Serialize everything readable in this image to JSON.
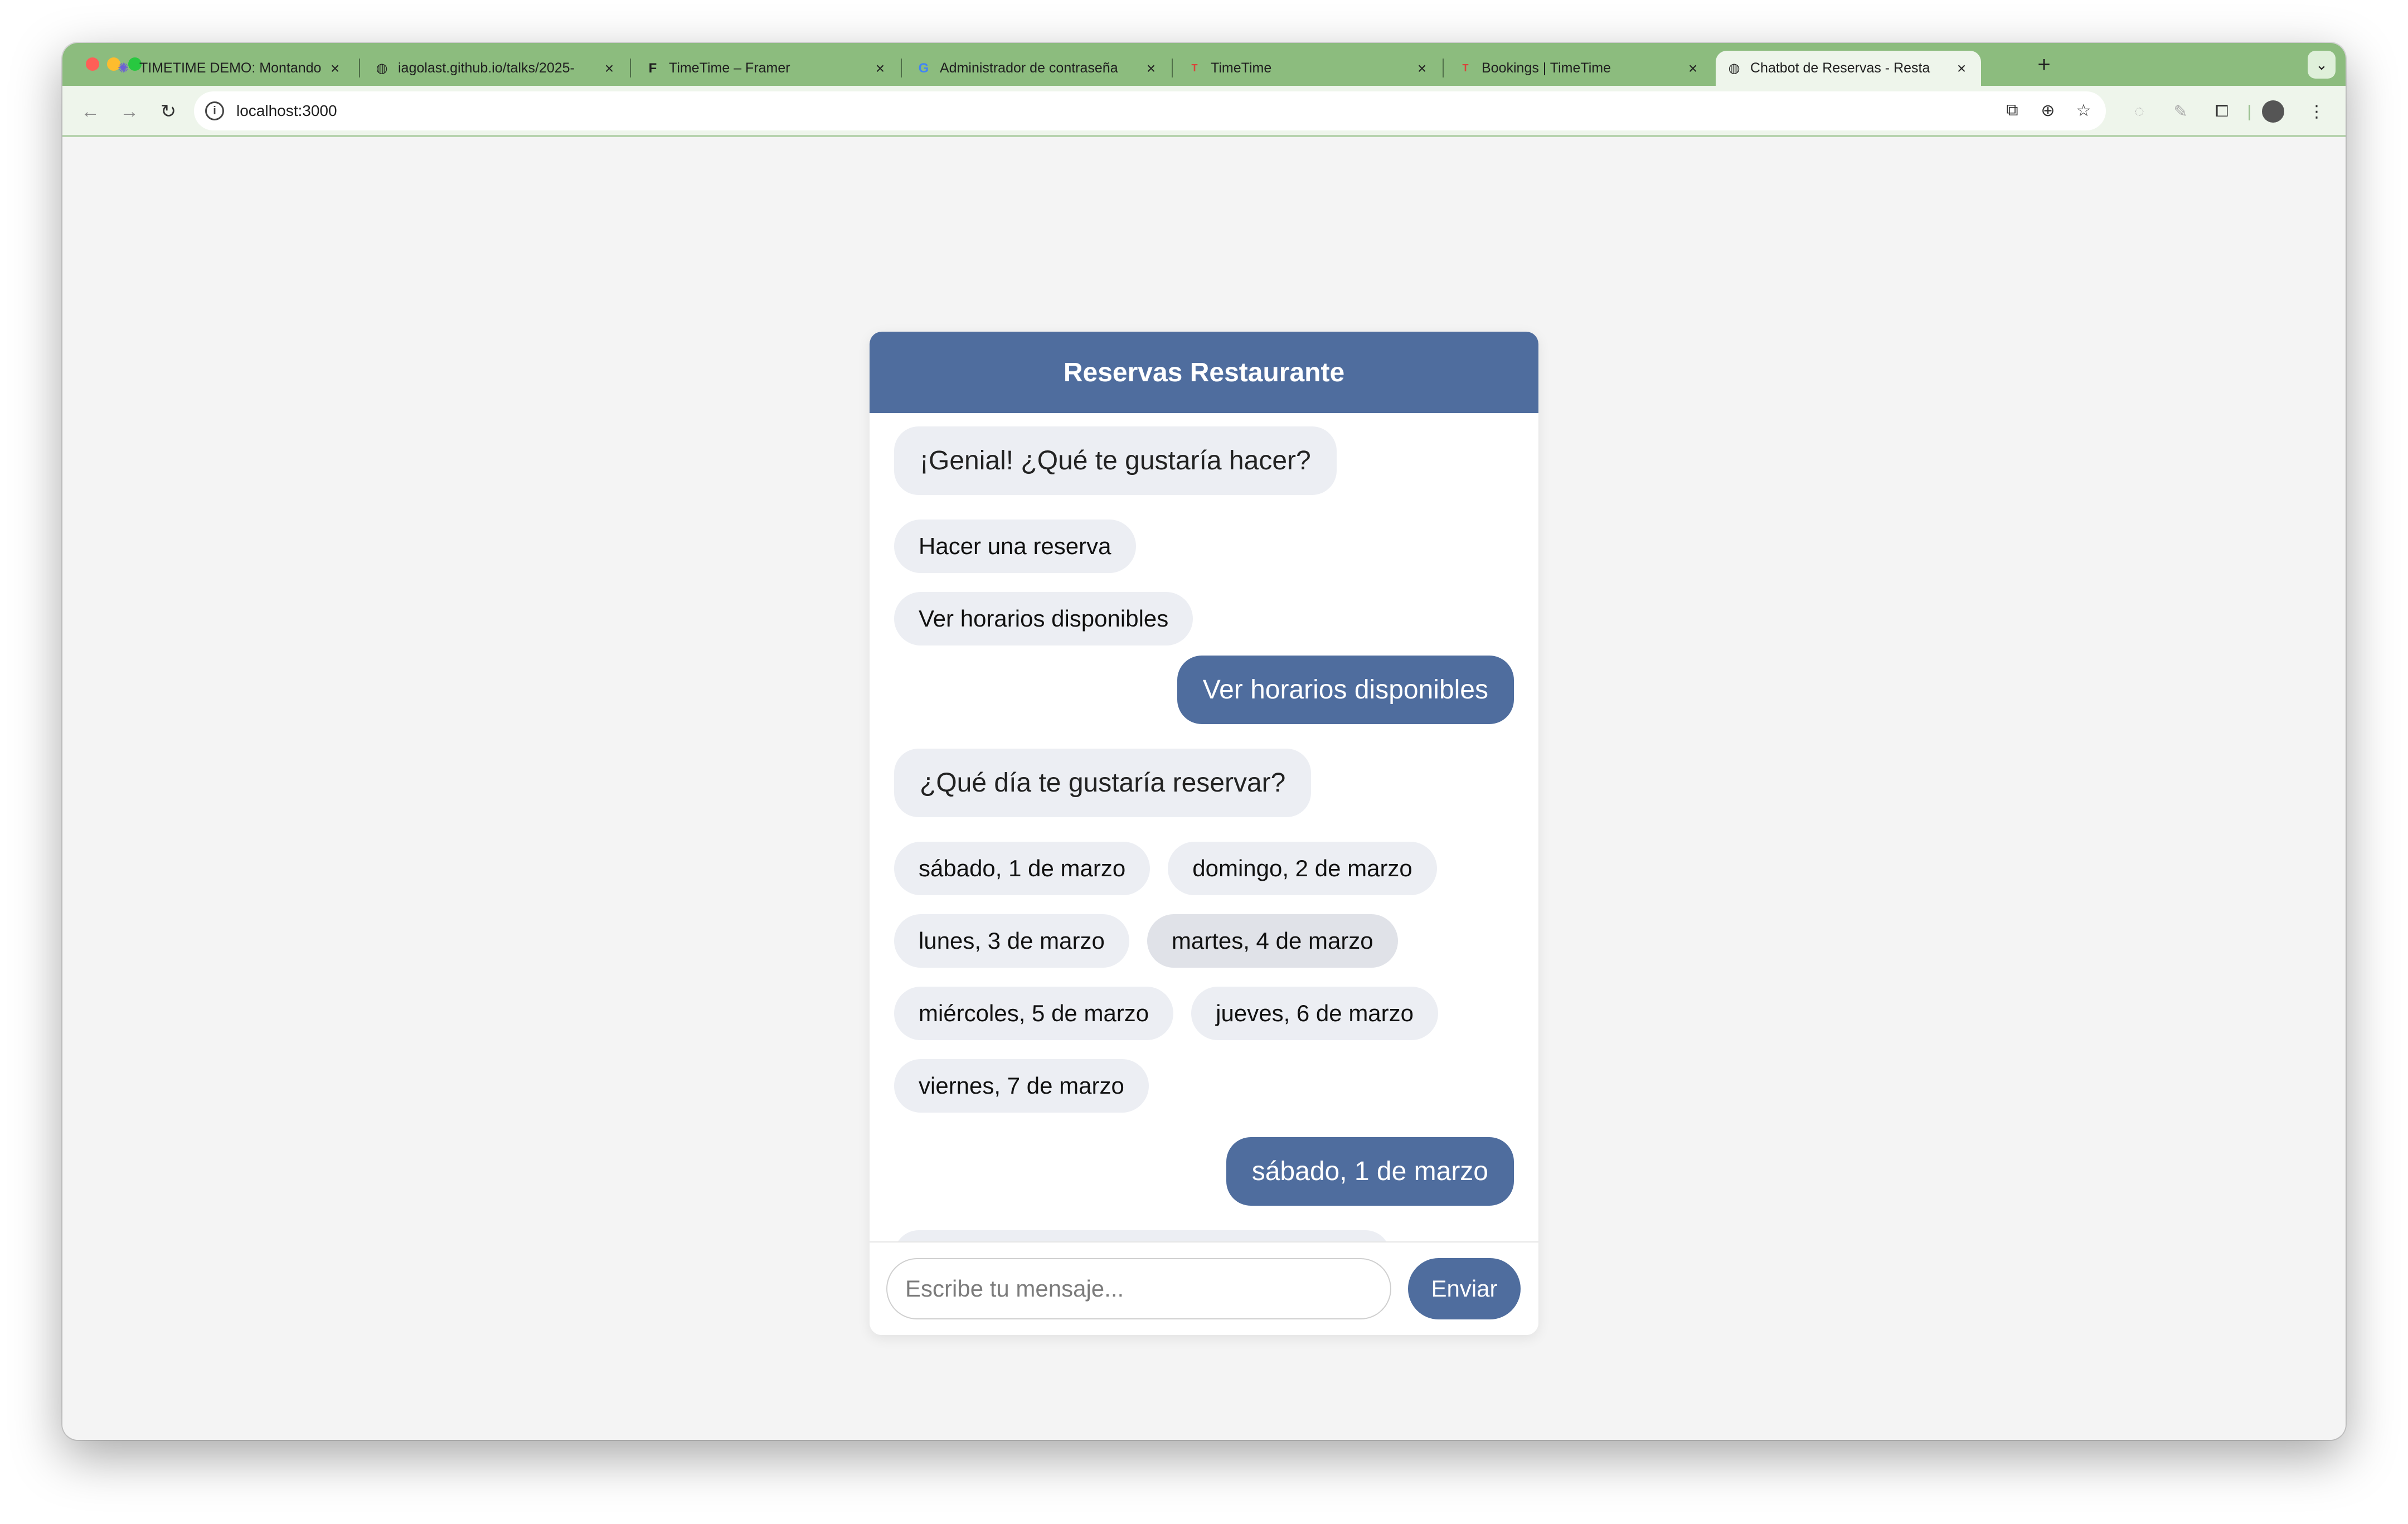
{
  "browser": {
    "tabs": [
      {
        "title": "TIMETIME DEMO: Montando",
        "favicon": "✺",
        "active": false
      },
      {
        "title": "iagolast.github.io/talks/2025-",
        "favicon": "◍",
        "active": false
      },
      {
        "title": "TimeTime – Framer",
        "favicon": "F",
        "active": false
      },
      {
        "title": "Administrador de contraseña",
        "favicon": "G",
        "active": false
      },
      {
        "title": "TimeTime",
        "favicon": "T",
        "active": false
      },
      {
        "title": "Bookings | TimeTime",
        "favicon": "T",
        "active": false
      },
      {
        "title": "Chatbot de Reservas - Resta",
        "favicon": "◍",
        "active": true
      }
    ],
    "new_tab": "+",
    "tab_search": "⌄",
    "url": "localhost:3000",
    "nav": {
      "back": "←",
      "forward": "→",
      "reload": "↻"
    },
    "icons": {
      "open_in_app": "⧉",
      "zoom": "⊕",
      "bookmark": "☆",
      "extension1": "◌",
      "extension2": "✎",
      "extensions": "⧠",
      "menu": "⋮"
    }
  },
  "chat": {
    "title": "Reservas Restaurante",
    "bot_msg_1": "¡Genial! ¿Qué te gustaría hacer?",
    "actions": [
      "Hacer una reserva",
      "Ver horarios disponibles"
    ],
    "user_msg_1": "Ver horarios disponibles",
    "bot_msg_2": "¿Qué día te gustaría reservar?",
    "days": [
      "sábado, 1 de marzo",
      "domingo, 2 de marzo",
      "lunes, 3 de marzo",
      "martes, 4 de marzo",
      "miércoles, 5 de marzo",
      "jueves, 6 de marzo",
      "viernes, 7 de marzo"
    ],
    "user_msg_2": "sábado, 1 de marzo",
    "input_placeholder": "Escribe tu mensaje...",
    "send_label": "Enviar"
  },
  "colors": {
    "accent": "#4f6d9e",
    "bubble_bot": "#eceef3",
    "tab_strip": "#8cbc7e",
    "toolbar": "#eef5eb"
  }
}
